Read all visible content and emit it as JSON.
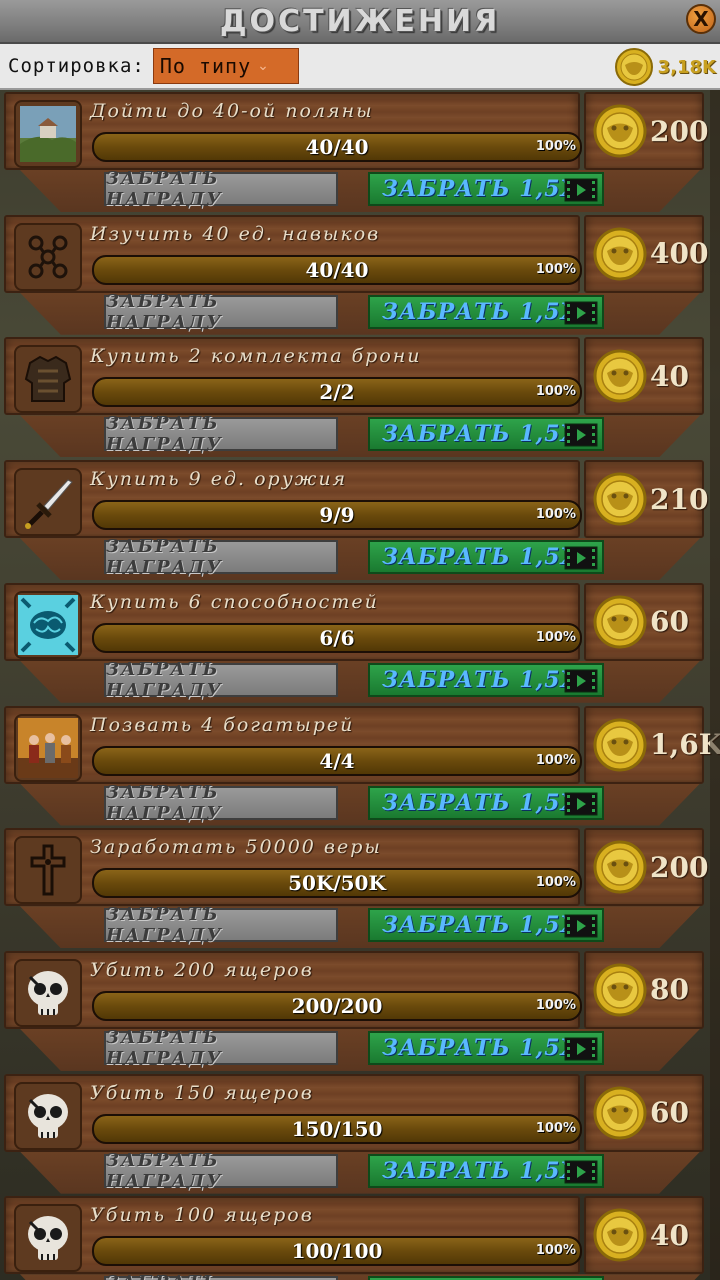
{
  "header": {
    "title": "ДОСТИЖЕНИЯ",
    "close_label": "X"
  },
  "sortbar": {
    "label": "Сортировка:",
    "selected": "По типу",
    "balance": "3,18K"
  },
  "buttons": {
    "claim": "ЗАБРАТЬ НАГРАДУ",
    "claim_x15": "ЗАБРАТЬ 1,5X"
  },
  "achievements": [
    {
      "title": "Дойти до 40-ой поляны",
      "count": "40/40",
      "percent": "100%",
      "progress": 1.0,
      "reward": "200",
      "icon": "landscape-icon"
    },
    {
      "title": "Изучить 40 ед. навыков",
      "count": "40/40",
      "percent": "100%",
      "progress": 1.0,
      "reward": "400",
      "icon": "skill-tree-icon"
    },
    {
      "title": "Купить 2 комплекта брони",
      "count": "2/2",
      "percent": "100%",
      "progress": 1.0,
      "reward": "40",
      "icon": "armor-icon"
    },
    {
      "title": "Купить 9 ед. оружия",
      "count": "9/9",
      "percent": "100%",
      "progress": 1.0,
      "reward": "210",
      "icon": "sword-icon"
    },
    {
      "title": "Купить 6 способностей",
      "count": "6/6",
      "percent": "100%",
      "progress": 1.0,
      "reward": "60",
      "icon": "brain-icon"
    },
    {
      "title": "Позвать 4 богатырей",
      "count": "4/4",
      "percent": "100%",
      "progress": 1.0,
      "reward": "1,6K",
      "icon": "warriors-icon"
    },
    {
      "title": "Заработать 50000 веры",
      "count": "50K/50K",
      "percent": "100%",
      "progress": 1.0,
      "reward": "200",
      "icon": "cross-icon"
    },
    {
      "title": "Убить 200 ящеров",
      "count": "200/200",
      "percent": "100%",
      "progress": 1.0,
      "reward": "80",
      "icon": "skull-icon"
    },
    {
      "title": "Убить 150 ящеров",
      "count": "150/150",
      "percent": "100%",
      "progress": 1.0,
      "reward": "60",
      "icon": "skull-icon"
    },
    {
      "title": "Убить 100 ящеров",
      "count": "100/100",
      "percent": "100%",
      "progress": 1.0,
      "reward": "40",
      "icon": "skull-icon"
    }
  ]
}
